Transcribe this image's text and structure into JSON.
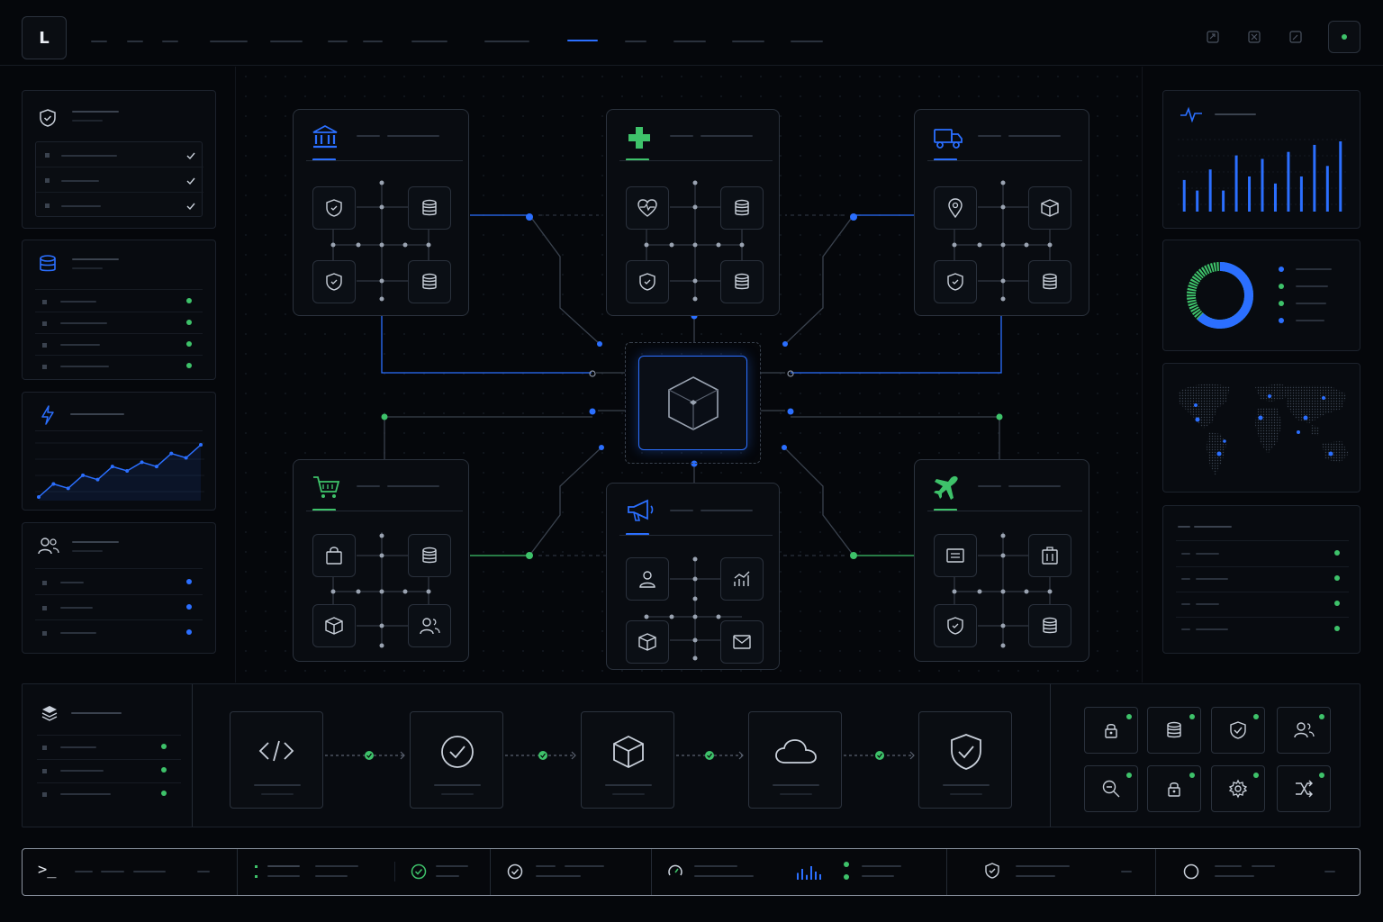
{
  "app": {
    "logo_letter": "L",
    "prompt_glyph": ">_"
  },
  "colors": {
    "accent_blue": "#2b6fff",
    "accent_green": "#3ec26a",
    "background": "#05070b",
    "panel_border": "#1c222c"
  },
  "icons": {
    "top_actions": [
      "share-icon",
      "expand-icon",
      "edit-icon"
    ],
    "left_panels": [
      "shield-icon",
      "database-icon",
      "lightning-icon",
      "users-icon"
    ],
    "sectors": [
      "bank-icon",
      "medical-cross-icon",
      "truck-icon",
      "cart-icon",
      "megaphone-icon",
      "airplane-icon"
    ],
    "pipeline": [
      "code-icon",
      "check-circle-icon",
      "cube-icon",
      "cloud-icon",
      "shield-check-icon"
    ],
    "modules": [
      "lock-icon",
      "database-icon",
      "shield-check-icon",
      "users-icon",
      "search-icon",
      "lock-icon",
      "gear-icon",
      "shuffle-icon"
    ]
  },
  "charts": {
    "line_trend": [
      2,
      5,
      4,
      7,
      6,
      9,
      8,
      10,
      9,
      12,
      11,
      14
    ],
    "bar_activity": [
      0.45,
      0.3,
      0.6,
      0.3,
      0.8,
      0.5,
      0.75,
      0.4,
      0.85,
      0.5,
      0.95,
      0.65,
      1.0
    ],
    "donut_share": [
      0.62,
      0.38
    ]
  }
}
